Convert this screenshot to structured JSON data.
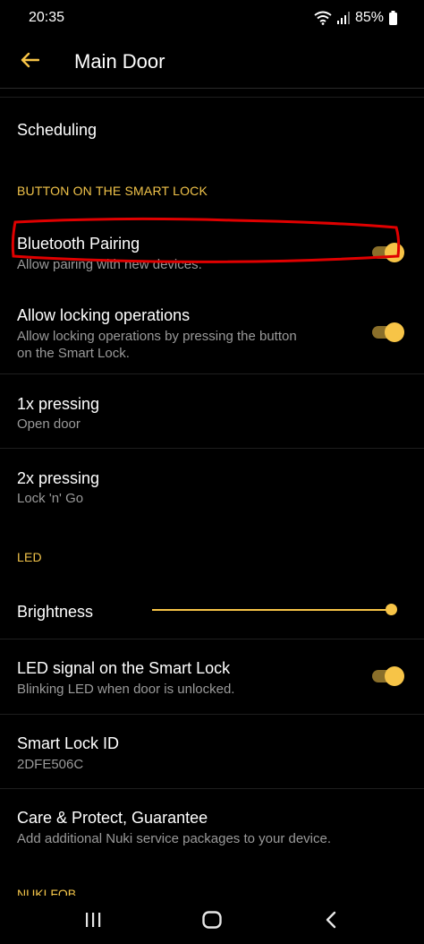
{
  "status_bar": {
    "time": "20:35",
    "battery": "85%"
  },
  "app_bar": {
    "title": "Main Door"
  },
  "rows": {
    "scheduling": {
      "title": "Scheduling"
    },
    "bluetooth_pairing": {
      "title": "Bluetooth Pairing",
      "subtitle": "Allow pairing with new devices.",
      "enabled": true
    },
    "allow_locking": {
      "title": "Allow locking operations",
      "subtitle_line1": "Allow locking operations by pressing the button",
      "subtitle_line2": "on the Smart Lock.",
      "enabled": true
    },
    "one_x": {
      "title": "1x pressing",
      "subtitle": "Open door"
    },
    "two_x": {
      "title": "2x pressing",
      "subtitle": "Lock 'n' Go"
    },
    "brightness": {
      "title": "Brightness",
      "level": 1.0
    },
    "led_signal": {
      "title": "LED signal on the Smart Lock",
      "subtitle": "Blinking LED when door is unlocked.",
      "enabled": true
    },
    "smart_lock_id": {
      "title": "Smart Lock ID",
      "value": "2DFE506C"
    },
    "care_protect": {
      "title": "Care & Protect, Guarantee",
      "subtitle": "Add additional Nuki service packages to your device."
    }
  },
  "sections": {
    "button_header": "BUTTON ON THE SMART LOCK",
    "led_header": "LED",
    "next_header_clipped": "NUKI FOB"
  },
  "colors": {
    "accent": "#f7c447",
    "highlight": "#e00000",
    "background": "#000000"
  },
  "icons": {
    "back": "arrow-left-icon",
    "recents": "recent-apps-icon",
    "home": "home-icon",
    "nav_back": "chevron-left-icon"
  }
}
